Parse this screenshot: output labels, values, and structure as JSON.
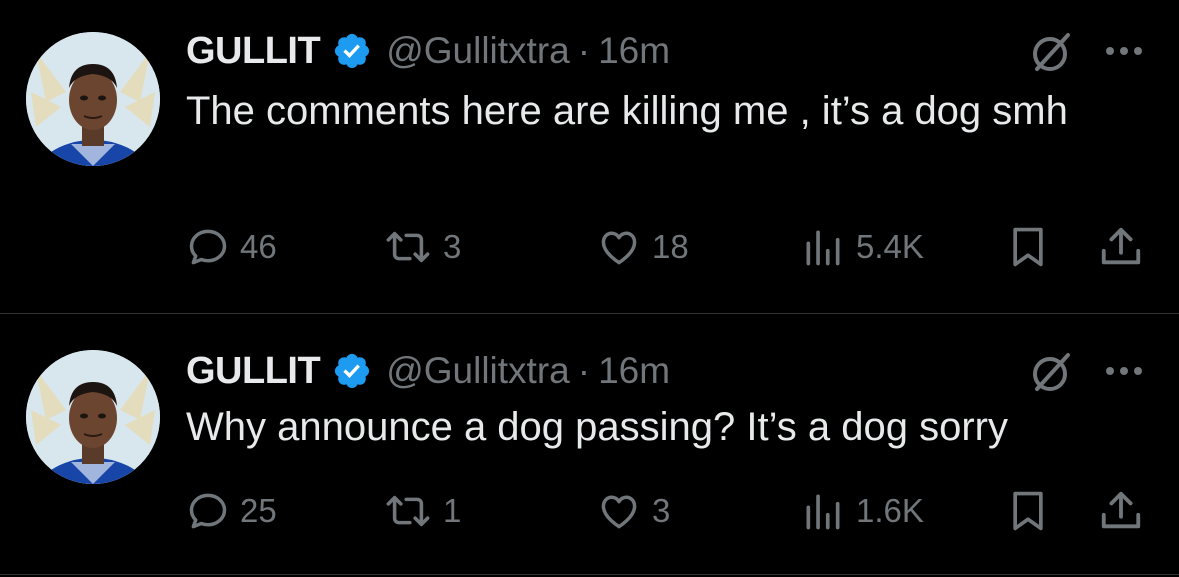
{
  "tweets": [
    {
      "display_name": "GULLIT",
      "handle": "@Gullitxtra",
      "separator": "·",
      "time": "16m",
      "text": "The comments here are killing me , it’s a dog smh",
      "replies": "46",
      "retweets": "3",
      "likes": "18",
      "views": "5.4K"
    },
    {
      "display_name": "GULLIT",
      "handle": "@Gullitxtra",
      "separator": "·",
      "time": "16m",
      "text": "Why announce a dog passing? It’s a dog sorry",
      "replies": "25",
      "retweets": "1",
      "likes": "3",
      "views": "1.6K"
    }
  ],
  "colors": {
    "background": "#000000",
    "text_primary": "#e7e9ea",
    "text_secondary": "#71767b",
    "verified_badge": "#1d9bf0",
    "divider": "#2f3336"
  },
  "icons": [
    "verified-badge-icon",
    "grok-icon",
    "more-icon",
    "reply-icon",
    "retweet-icon",
    "like-icon",
    "views-icon",
    "bookmark-icon",
    "share-icon"
  ]
}
